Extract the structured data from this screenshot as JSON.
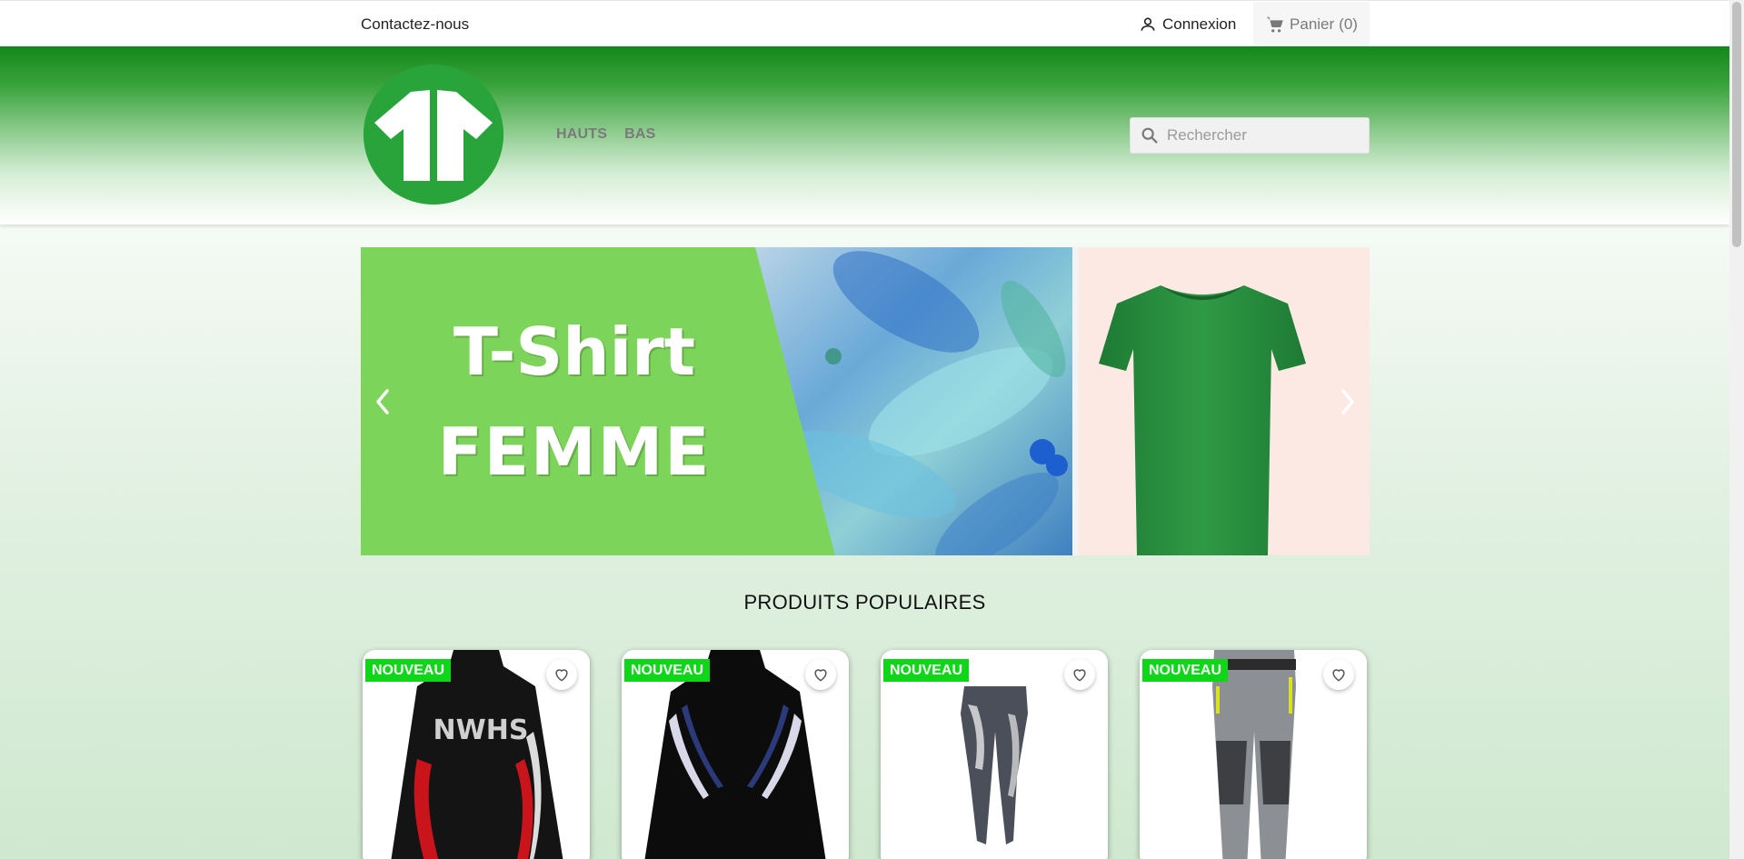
{
  "topbar": {
    "contact_label": "Contactez-nous",
    "login_label": "Connexion",
    "cart_label": "Panier",
    "cart_count": "(0)"
  },
  "header": {
    "menu": [
      {
        "label": "HAUTS"
      },
      {
        "label": "BAS"
      }
    ],
    "search_placeholder": "Rechercher"
  },
  "carousel": {
    "slide_line1": "T-Shirt",
    "slide_line2": "FEMME"
  },
  "products": {
    "title": "PRODUITS POPULAIRES",
    "items": [
      {
        "badge": "NOUVEAU"
      },
      {
        "badge": "NOUVEAU"
      },
      {
        "badge": "NOUVEAU"
      },
      {
        "badge": "NOUVEAU"
      }
    ]
  },
  "colors": {
    "brand_green": "#14881a",
    "badge_green": "#0fd619",
    "banner_green": "#7dd45b"
  }
}
